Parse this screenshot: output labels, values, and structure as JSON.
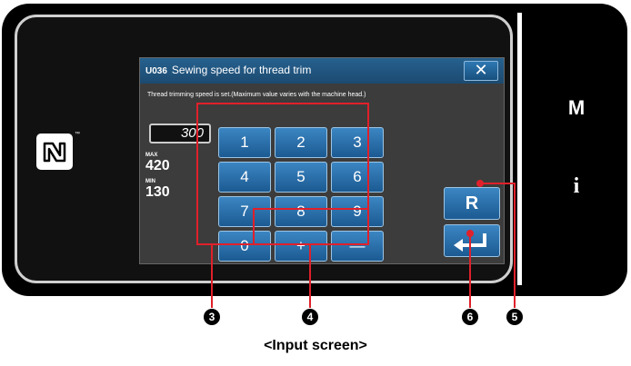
{
  "dialog": {
    "code": "U036",
    "title": "Sewing speed for thread trim",
    "close_label": "✕",
    "description": "Thread trimming speed is set.(Maximum value varies with the machine head.)"
  },
  "value_display": "300",
  "limits": {
    "max_label": "MAX",
    "max_value": "420",
    "min_label": "MIN",
    "min_value": "130"
  },
  "keypad": {
    "k1": "1",
    "k2": "2",
    "k3": "3",
    "k4": "4",
    "k5": "5",
    "k6": "6",
    "k7": "7",
    "k8": "8",
    "k9": "9",
    "k0": "0",
    "plus": "+",
    "minus": "—"
  },
  "reset_label": "R",
  "enter_icon": "enter-return-icon",
  "side_panel": {
    "menu_label": "M",
    "info_label": "i"
  },
  "nfc_icon": "nfc-icon",
  "nfc_trademark": "™",
  "callouts": {
    "c3": "3",
    "c4": "4",
    "c6": "6",
    "c5": "5"
  },
  "caption": "<Input screen>",
  "colors": {
    "callout": "#e0202a",
    "button": "#2d78b2",
    "titlebar": "#26618f"
  }
}
